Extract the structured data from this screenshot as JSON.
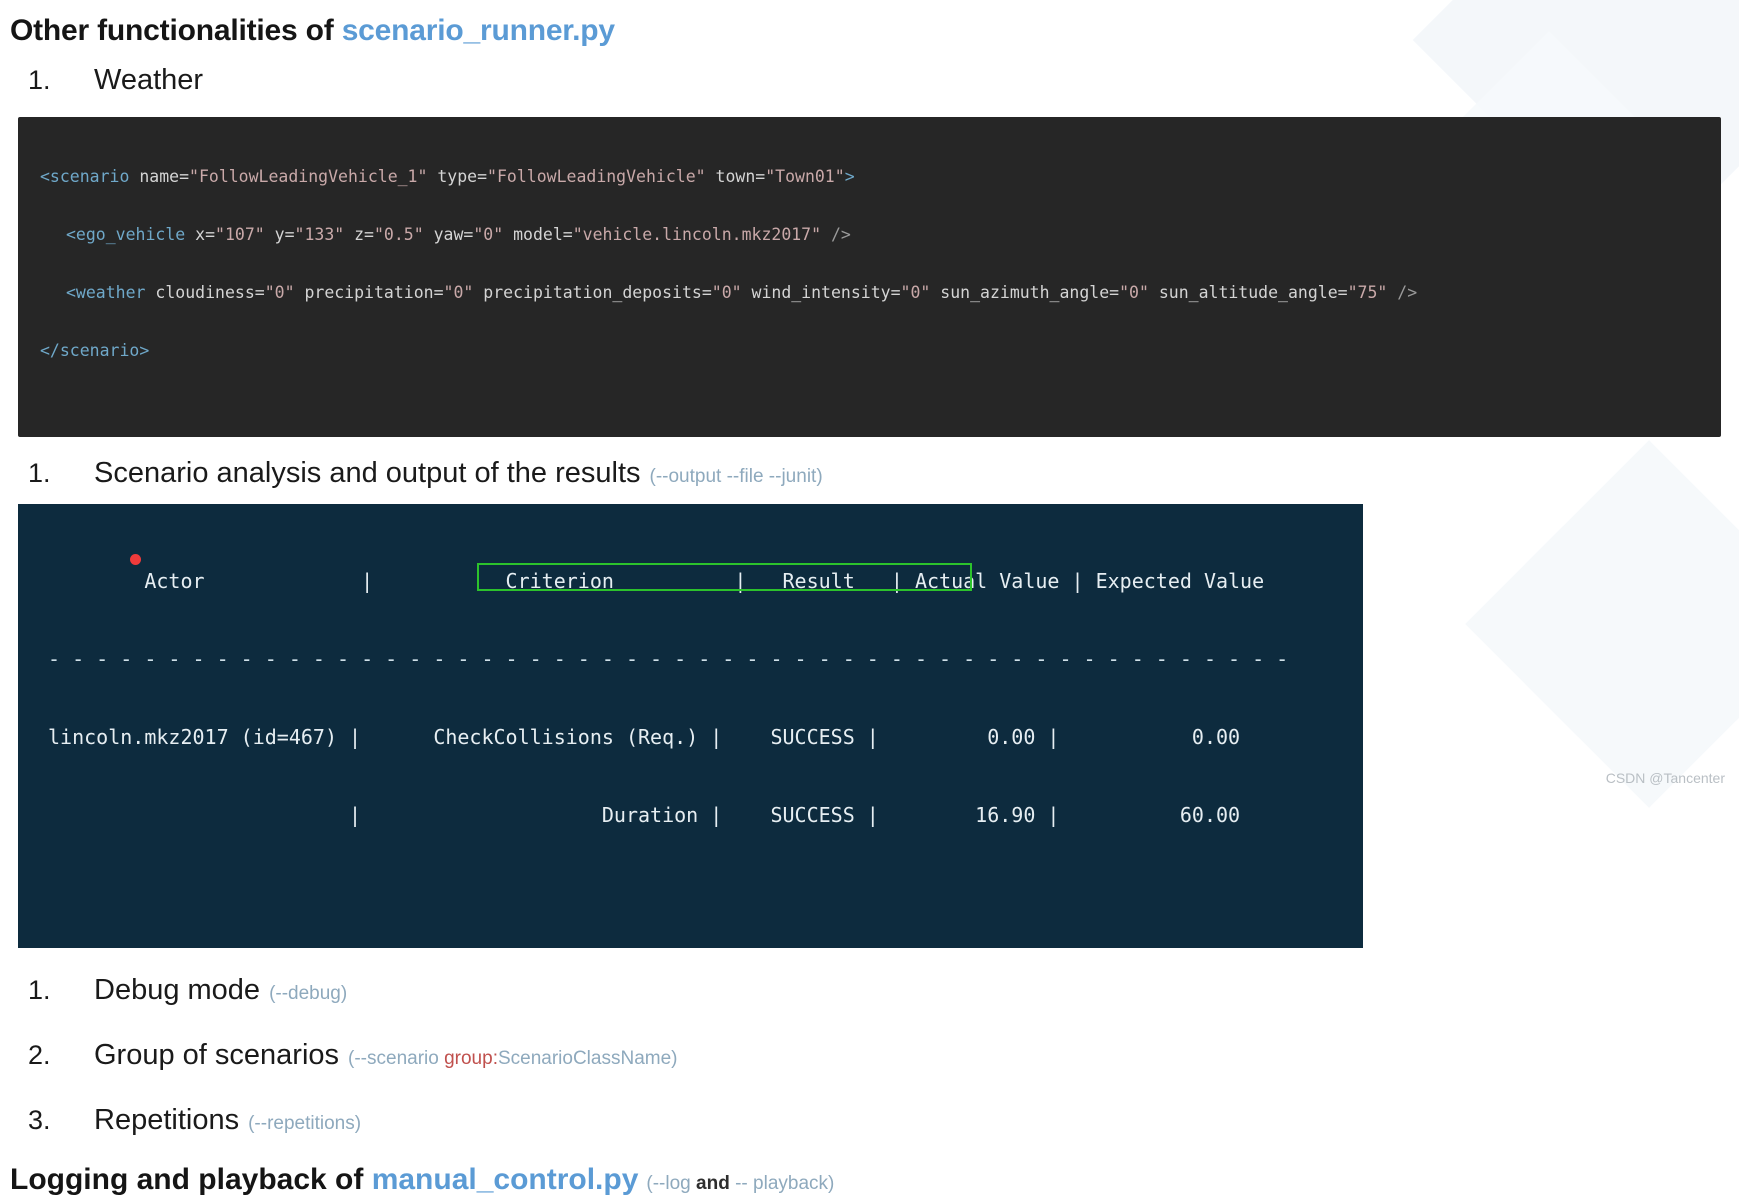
{
  "heading": {
    "prefix": "Other functionalities of ",
    "accent": "scenario_runner.py"
  },
  "items": [
    {
      "num": "1.",
      "text": "Weather",
      "flag": ""
    },
    {
      "num": "1.",
      "text": "Scenario analysis and output of the results",
      "flag": "(--output --file --junit)"
    },
    {
      "num": "1.",
      "text": "Debug mode",
      "flag": "(--debug)"
    },
    {
      "num": "2.",
      "text": "Group of scenarios",
      "flag_pre": "(--scenario ",
      "flag_hl": "group:",
      "flag_post": "ScenarioClassName)"
    },
    {
      "num": "3.",
      "text": "Repetitions",
      "flag": "(--repetitions)"
    }
  ],
  "code": {
    "line1": {
      "tag_open": "<scenario",
      "a1": " name=",
      "v1": "\"FollowLeadingVehicle_1\"",
      "a2": " type=",
      "v2": "\"FollowLeadingVehicle\"",
      "a3": " town=",
      "v3": "\"Town01\"",
      "close": ">"
    },
    "line2": {
      "tag_open": "<ego_vehicle",
      "a1": " x=",
      "v1": "\"107\"",
      "a2": " y=",
      "v2": "\"133\"",
      "a3": " z=",
      "v3": "\"0.5\"",
      "a4": " yaw=",
      "v4": "\"0\"",
      "a5": " model=",
      "v5": "\"vehicle.lincoln.mkz2017\"",
      "close": " />"
    },
    "line3": {
      "tag_open": "<weather",
      "a1": " cloudiness=",
      "v1": "\"0\"",
      "a2": " precipitation=",
      "v2": "\"0\"",
      "a3": " precipitation_deposits=",
      "v3": "\"0\"",
      "a4": " wind_intensity=",
      "v4": "\"0\"",
      "a5": " sun_azimuth_angle=",
      "v5": "\"0\"",
      "a6": " sun_altitude_angle=",
      "v6": "\"75\"",
      "close": " />"
    },
    "line4": {
      "tag_close": "</scenario>"
    }
  },
  "terminal": {
    "header": "        Actor             |           Criterion          |   Result   | Actual Value | Expected Value",
    "divider": "- - - - - - - - - - - - - - - - - - - - - - - - - - - - - - - - - - - - - - - - - - - - - - - - - - - -",
    "row1": "lincoln.mkz2017 (id=467) |      CheckCollisions (Req.) |    SUCCESS |         0.00 |           0.00",
    "row2": "                         |                    Duration |    SUCCESS |        16.90 |          60.00",
    "columns": [
      "Actor",
      "Criterion",
      "Result",
      "Actual Value",
      "Expected Value"
    ],
    "rows": [
      {
        "actor": "lincoln.mkz2017 (id=467)",
        "criterion": "CheckCollisions (Req.)",
        "result": "SUCCESS",
        "actual": "0.00",
        "expected": "0.00"
      },
      {
        "actor": "",
        "criterion": "Duration",
        "result": "SUCCESS",
        "actual": "16.90",
        "expected": "60.00"
      }
    ],
    "highlight_color": "#2cc22c",
    "marker_color": "#ef3b3b",
    "background": "#0d2b3e"
  },
  "footer": {
    "prefix": "Logging and playback of ",
    "accent": "manual_control.py",
    "flag_pre": "(--log ",
    "flag_and": "and",
    "flag_post": " -- playback)"
  },
  "watermark": "CSDN @Tancenter"
}
